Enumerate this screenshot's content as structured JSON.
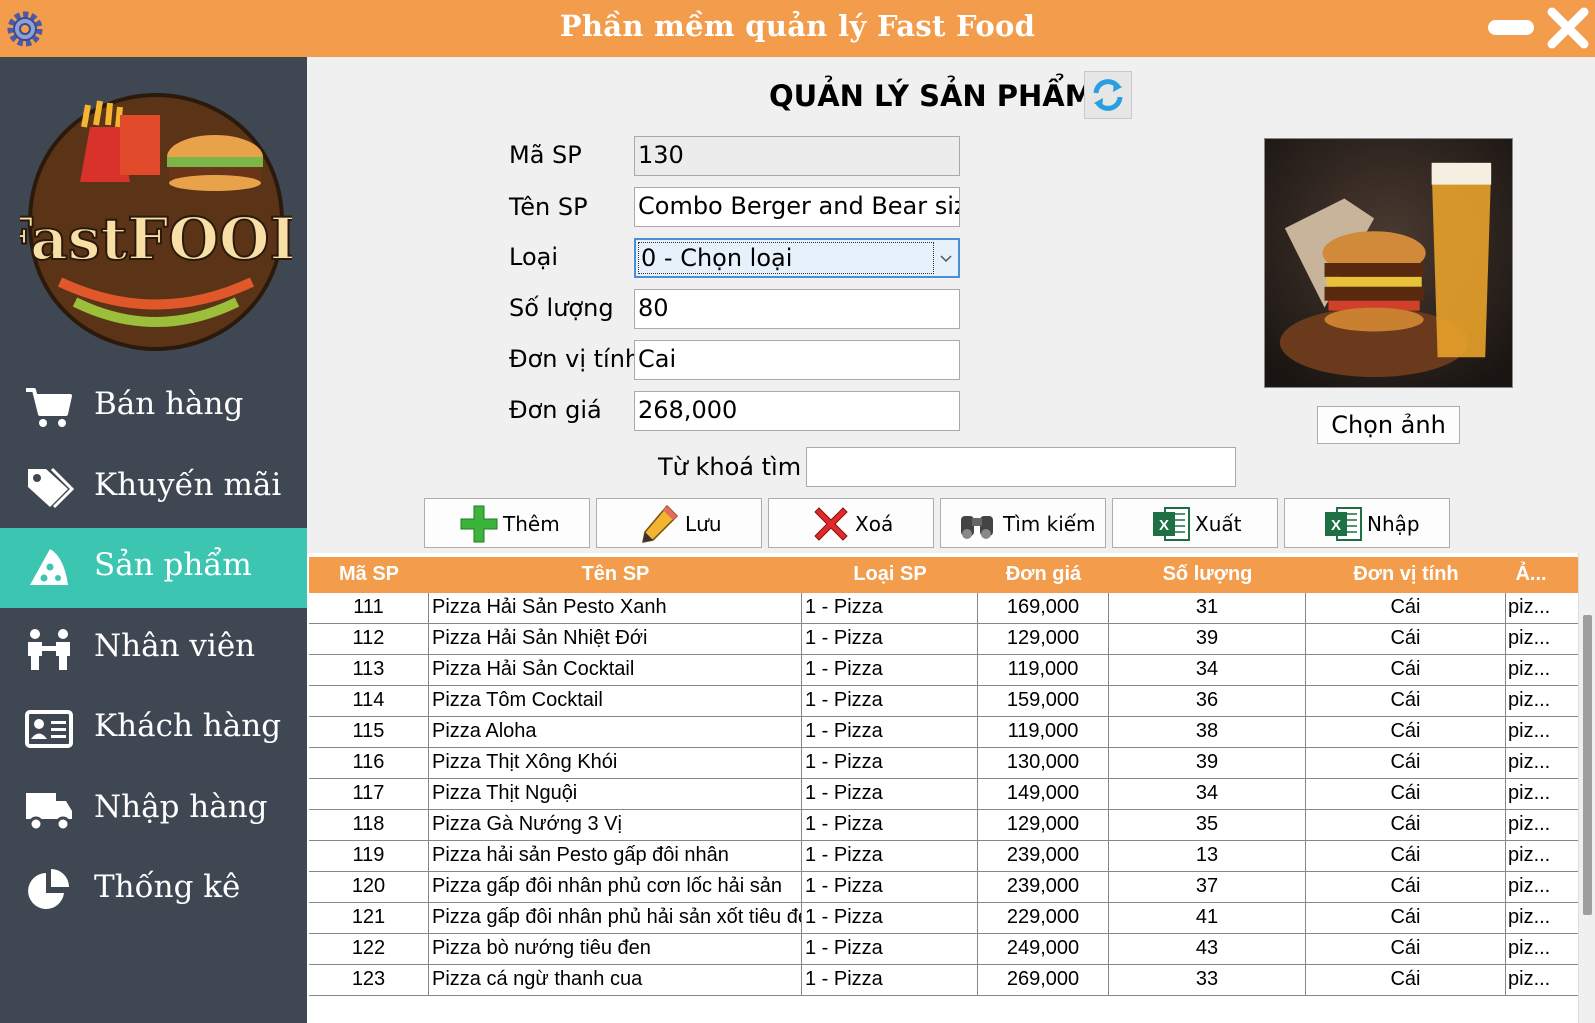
{
  "window": {
    "title": "Phần mềm quản lý Fast Food"
  },
  "sidebar": {
    "logo_text": "Fast Food",
    "items": [
      {
        "label": "Bán hàng",
        "icon": "cart-icon"
      },
      {
        "label": "Khuyến mãi",
        "icon": "tag-icon"
      },
      {
        "label": "Sản phẩm",
        "icon": "pizza-icon",
        "active": true
      },
      {
        "label": "Nhân viên",
        "icon": "staff-icon"
      },
      {
        "label": "Khách hàng",
        "icon": "id-card-icon"
      },
      {
        "label": "Nhập hàng",
        "icon": "truck-icon"
      },
      {
        "label": "Thống kê",
        "icon": "pie-chart-icon"
      }
    ]
  },
  "main": {
    "title": "QUẢN LÝ SẢN PHẨM",
    "form": {
      "ma_sp": {
        "label": "Mã SP",
        "value": "130"
      },
      "ten_sp": {
        "label": "Tên SP",
        "value": "Combo Berger and Bear size"
      },
      "loai": {
        "label": "Loại",
        "value": "0 - Chọn loại"
      },
      "so_luong": {
        "label": "Số lượng",
        "value": "80"
      },
      "don_vi": {
        "label": "Đơn vị tính",
        "value": "Cai"
      },
      "don_gia": {
        "label": "Đơn giá",
        "value": "268,000"
      }
    },
    "choose_image_label": "Chọn ảnh",
    "search": {
      "label": "Từ khoá tìm",
      "value": ""
    },
    "toolbar": {
      "add": "Thêm",
      "save": "Lưu",
      "delete": "Xoá",
      "search": "Tìm kiếm",
      "export": "Xuất",
      "import": "Nhập"
    }
  },
  "table": {
    "headers": [
      "Mã SP",
      "Tên SP",
      "Loại SP",
      "Đơn giá",
      "Số lượng",
      "Đơn vị tính",
      "Ả..."
    ],
    "rows": [
      [
        "111",
        "Pizza Hải Sản Pesto Xanh",
        "1 - Pizza",
        "169,000",
        "31",
        "Cái",
        "piz..."
      ],
      [
        "112",
        "Pizza Hải Sản Nhiệt Đới",
        "1 - Pizza",
        "129,000",
        "39",
        "Cái",
        "piz..."
      ],
      [
        "113",
        "Pizza Hải Sản Cocktail",
        "1 - Pizza",
        "119,000",
        "34",
        "Cái",
        "piz..."
      ],
      [
        "114",
        "Pizza Tôm Cocktail",
        "1 - Pizza",
        "159,000",
        "36",
        "Cái",
        "piz..."
      ],
      [
        "115",
        "Pizza Aloha",
        "1 - Pizza",
        "119,000",
        "38",
        "Cái",
        "piz..."
      ],
      [
        "116",
        "Pizza Thịt Xông Khói",
        "1 - Pizza",
        "130,000",
        "39",
        "Cái",
        "piz..."
      ],
      [
        "117",
        "Pizza Thịt Nguội",
        "1 - Pizza",
        "149,000",
        "34",
        "Cái",
        "piz..."
      ],
      [
        "118",
        "Pizza Gà Nướng 3 Vị",
        "1 - Pizza",
        "129,000",
        "35",
        "Cái",
        "piz..."
      ],
      [
        "119",
        "Pizza hải sản Pesto gấp đôi nhân",
        "1 - Pizza",
        "239,000",
        "13",
        "Cái",
        "piz..."
      ],
      [
        "120",
        "Pizza gấp đôi nhân phủ cơn lốc hải sản",
        "1 - Pizza",
        "239,000",
        "37",
        "Cái",
        "piz..."
      ],
      [
        "121",
        "Pizza gấp đôi nhân phủ hải sản xốt tiêu đen",
        "1 - Pizza",
        "229,000",
        "41",
        "Cái",
        "piz..."
      ],
      [
        "122",
        "Pizza bò nướng tiêu đen",
        "1 - Pizza",
        "249,000",
        "43",
        "Cái",
        "piz..."
      ],
      [
        "123",
        "Pizza cá ngừ thanh cua",
        "1 - Pizza",
        "269,000",
        "33",
        "Cái",
        "piz..."
      ]
    ]
  },
  "colors": {
    "titlebar": "#f39c4b",
    "sidebar": "#3f4852",
    "active_item": "#3cc6b2",
    "grid_header": "#f39c4b"
  }
}
